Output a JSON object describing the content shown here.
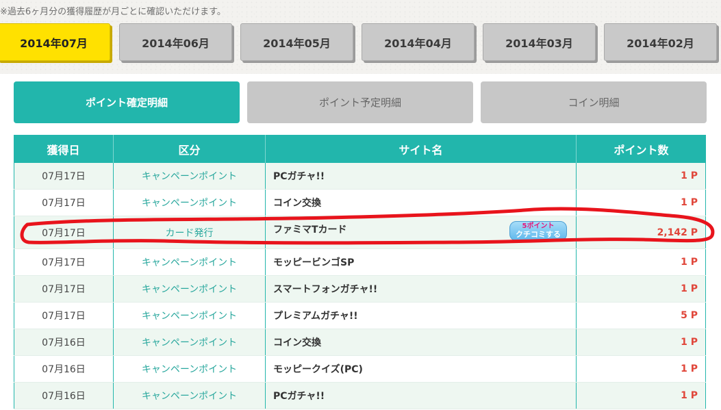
{
  "note": "※過去6ヶ月分の獲得履歴が月ごとに確認いただけます。",
  "month_tabs": [
    {
      "label": "2014年07月",
      "active": true
    },
    {
      "label": "2014年06月",
      "active": false
    },
    {
      "label": "2014年05月",
      "active": false
    },
    {
      "label": "2014年04月",
      "active": false
    },
    {
      "label": "2014年03月",
      "active": false
    },
    {
      "label": "2014年02月",
      "active": false
    }
  ],
  "sub_tabs": [
    {
      "label": "ポイント確定明細",
      "active": true
    },
    {
      "label": "ポイント予定明細",
      "active": false
    },
    {
      "label": "コイン明細",
      "active": false
    }
  ],
  "table": {
    "headers": [
      "獲得日",
      "区分",
      "サイト名",
      "ポイント数"
    ],
    "rows": [
      {
        "date": "07月17日",
        "category": "キャンペーンポイント",
        "site": "PCガチャ!!",
        "points": "1 P"
      },
      {
        "date": "07月17日",
        "category": "キャンペーンポイント",
        "site": "コイン交換",
        "points": "1 P"
      },
      {
        "date": "07月17日",
        "category": "カード発行",
        "site": "ファミマTカード",
        "points": "2,142 P",
        "badge_line1": "5ポイント",
        "badge_line2": "クチコミする"
      },
      {
        "date": "07月17日",
        "category": "キャンペーンポイント",
        "site": "モッピービンゴSP",
        "points": "1 P"
      },
      {
        "date": "07月17日",
        "category": "キャンペーンポイント",
        "site": "スマートフォンガチャ!!",
        "points": "1 P"
      },
      {
        "date": "07月17日",
        "category": "キャンペーンポイント",
        "site": "プレミアムガチャ!!",
        "points": "5 P"
      },
      {
        "date": "07月16日",
        "category": "キャンペーンポイント",
        "site": "コイン交換",
        "points": "1 P"
      },
      {
        "date": "07月16日",
        "category": "キャンペーンポイント",
        "site": "モッピークイズ(PC)",
        "points": "1 P"
      },
      {
        "date": "07月16日",
        "category": "キャンペーンポイント",
        "site": "PCガチャ!!",
        "points": "1 P"
      }
    ]
  },
  "colors": {
    "accent": "#22b6ac",
    "active_month": "#ffe100",
    "points_text": "#e0463a",
    "highlight_stroke": "#e8141c"
  }
}
